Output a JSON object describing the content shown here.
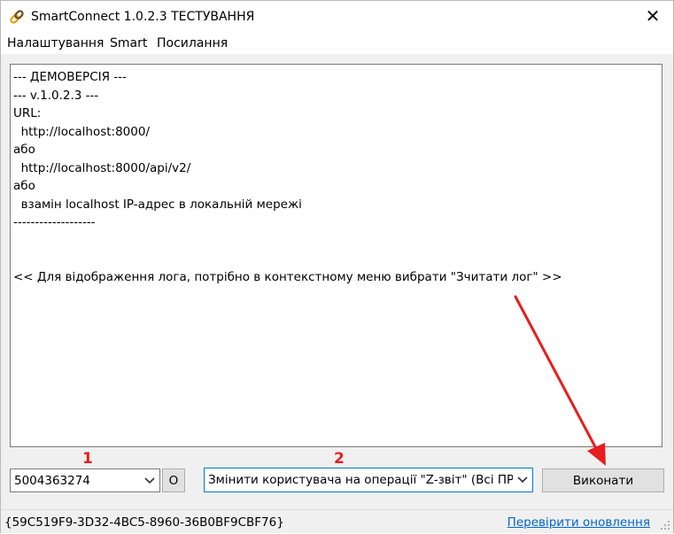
{
  "window": {
    "title": "SmartConnect 1.0.2.3 ТЕСТУВАННЯ",
    "icon": "chain-link-icon",
    "close_label": "✕"
  },
  "menu": {
    "items": [
      "Налаштування",
      "Smart",
      "Посилання"
    ]
  },
  "log": {
    "lines": [
      "--- ДЕМОВЕРСІЯ ---",
      "--- v.1.0.2.3 ---",
      "URL:",
      "  http://localhost:8000/",
      "або",
      "  http://localhost:8000/api/v2/",
      "або",
      "  взамін localhost IP-адрес в локальній мережі",
      "-------------------",
      "",
      "",
      "<< Для відображення лога, потрібно в контекстному меню вибрати \"Зчитати лог\" >>"
    ]
  },
  "annotations": {
    "label_1": "1",
    "label_2": "2",
    "color": "#e81d1d"
  },
  "controls": {
    "device_select": {
      "value": "5004363274"
    },
    "o_button": {
      "label": "O"
    },
    "operation_select": {
      "value": "Змінити користувача на операції \"Z-звіт\" (Всі ПРРО)"
    },
    "execute_button": {
      "label": "Виконати"
    }
  },
  "status": {
    "guid": "{59C519F9-3D32-4BC5-8960-36B0BF9CBF76}",
    "update_link": "Перевірити оновлення"
  },
  "colors": {
    "accent": "#0078d7",
    "link": "#0066cc",
    "annotation": "#e81d1d"
  }
}
